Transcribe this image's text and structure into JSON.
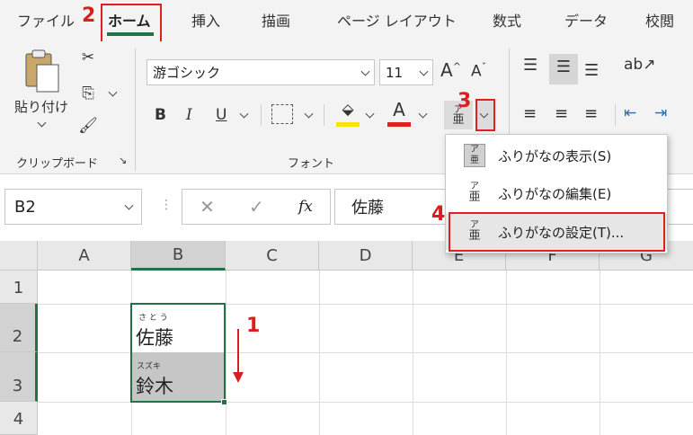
{
  "tabs": [
    "ファイル",
    "ホーム",
    "挿入",
    "描画",
    "ページ レイアウト",
    "数式",
    "データ",
    "校閲"
  ],
  "ribbon": {
    "paste_label": "貼り付け",
    "clipboard_group": "クリップボード",
    "font_group": "フォント",
    "font_name": "游ゴシック",
    "font_size": "11",
    "bold": "B",
    "italic": "I",
    "underline": "U",
    "font_color_glyph": "A",
    "increase_font": "A",
    "decrease_font": "A",
    "phonetic_ruby": "ア",
    "phonetic_base": "亜",
    "fx": "fx"
  },
  "dropdown_menu": [
    {
      "label": "ふりがなの表示(S)",
      "icon_top": "ア",
      "icon_base": "亜"
    },
    {
      "label": "ふりがなの編集(E)",
      "icon_top": "ア",
      "icon_base": "亜"
    },
    {
      "label": "ふりがなの設定(T)...",
      "icon_top": "ア",
      "icon_base": "亜"
    }
  ],
  "name_box": "B2",
  "formula_value": "佐藤",
  "columns": [
    "A",
    "B",
    "C",
    "D",
    "E",
    "F",
    "G"
  ],
  "rows": [
    "1",
    "2",
    "3",
    "4"
  ],
  "cells": [
    {
      "ref": "B2",
      "ruby": "さ と う",
      "text": "佐藤"
    },
    {
      "ref": "B3",
      "ruby": "スズキ",
      "text": "鈴木"
    }
  ],
  "steps": [
    "1",
    "2",
    "3",
    "4"
  ],
  "colors": {
    "accent": "#217346",
    "highlight": "#e02020",
    "step": "#d81f1f",
    "selection": "#c6c6c6",
    "fill_yellow": "#f5e50a",
    "font_red": "#e02020"
  }
}
